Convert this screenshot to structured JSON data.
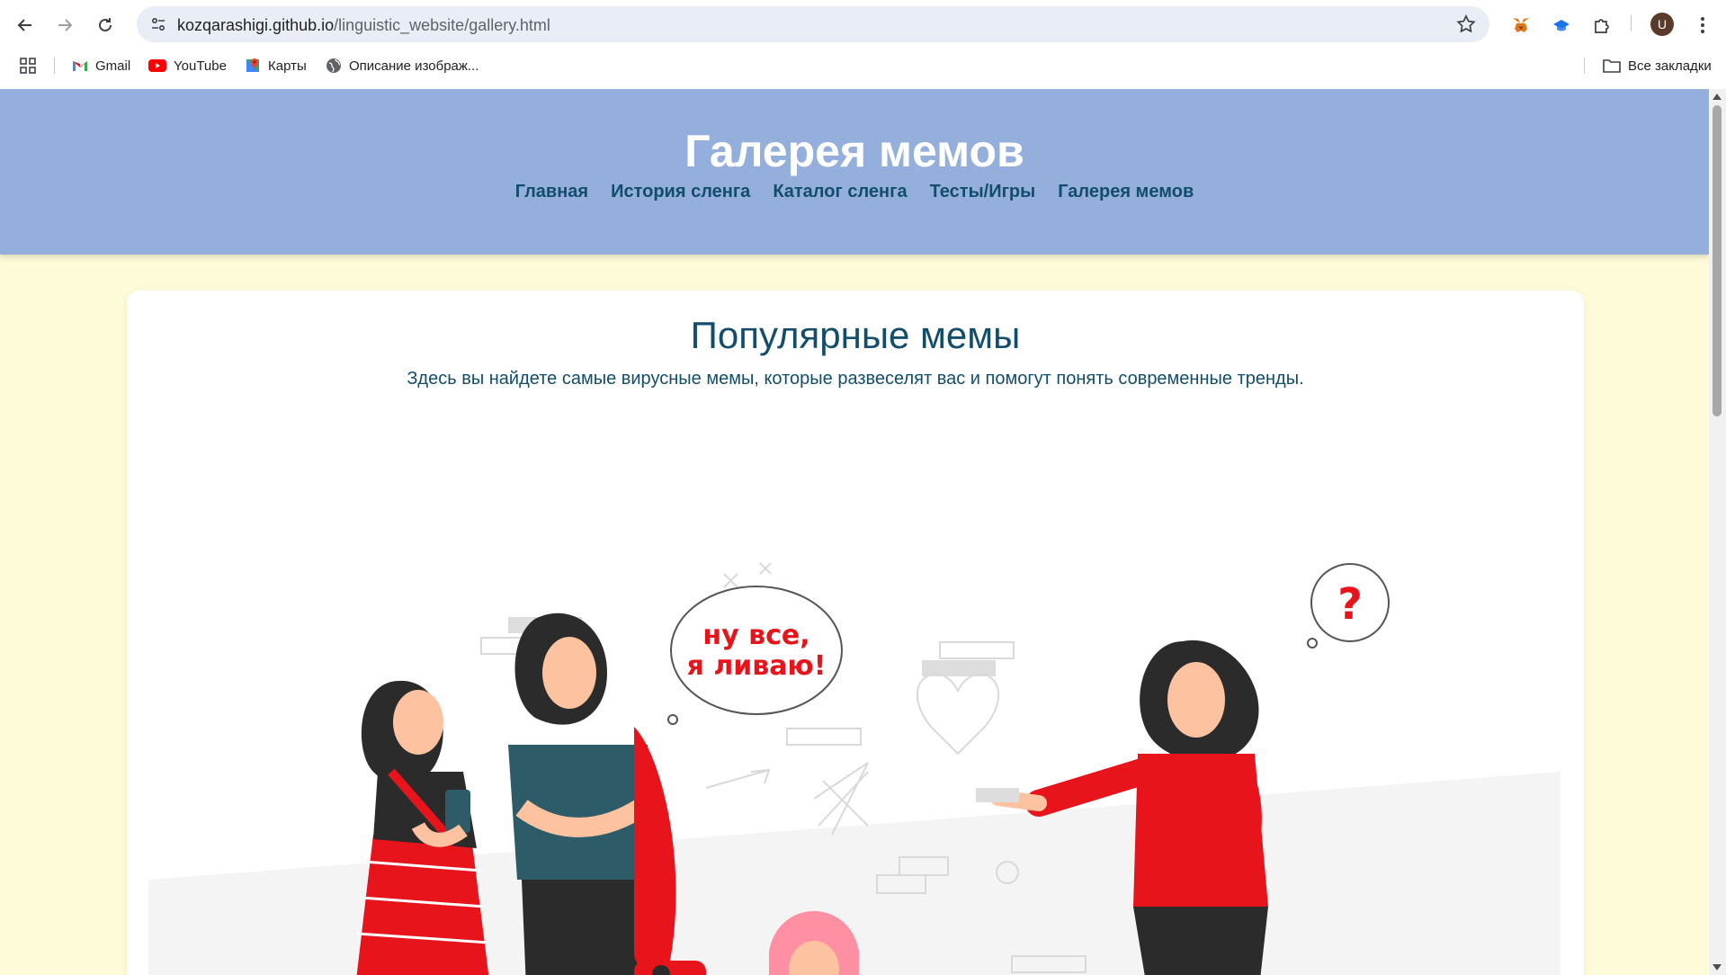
{
  "browser": {
    "url_host": "kozqarashigi.github.io",
    "url_path": "/linguistic_website/gallery.html",
    "profile_initial": "U",
    "bookmarks": [
      {
        "label": "Gmail",
        "icon": "gmail-icon"
      },
      {
        "label": "YouTube",
        "icon": "youtube-icon"
      },
      {
        "label": "Карты",
        "icon": "maps-icon"
      },
      {
        "label": "Описание изображ...",
        "icon": "globe-icon"
      }
    ],
    "all_bookmarks_label": "Все закладки"
  },
  "site": {
    "title": "Галерея мемов",
    "nav": [
      "Главная",
      "История сленга",
      "Каталог сленга",
      "Тесты/Игры",
      "Галерея мемов"
    ]
  },
  "main": {
    "heading": "Популярные мемы",
    "lead": "Здесь вы найдете самые вирусные мемы, которые развеселят вас и помогут понять современные тренды.",
    "meme": {
      "speech_line1": "ну все,",
      "speech_line2": "я ливаю!",
      "thought": "?"
    }
  },
  "colors": {
    "header_bg": "#94afdb",
    "page_bg": "#fdfbd8",
    "nav_text": "#124e6b",
    "accent_red": "#e8141c"
  }
}
